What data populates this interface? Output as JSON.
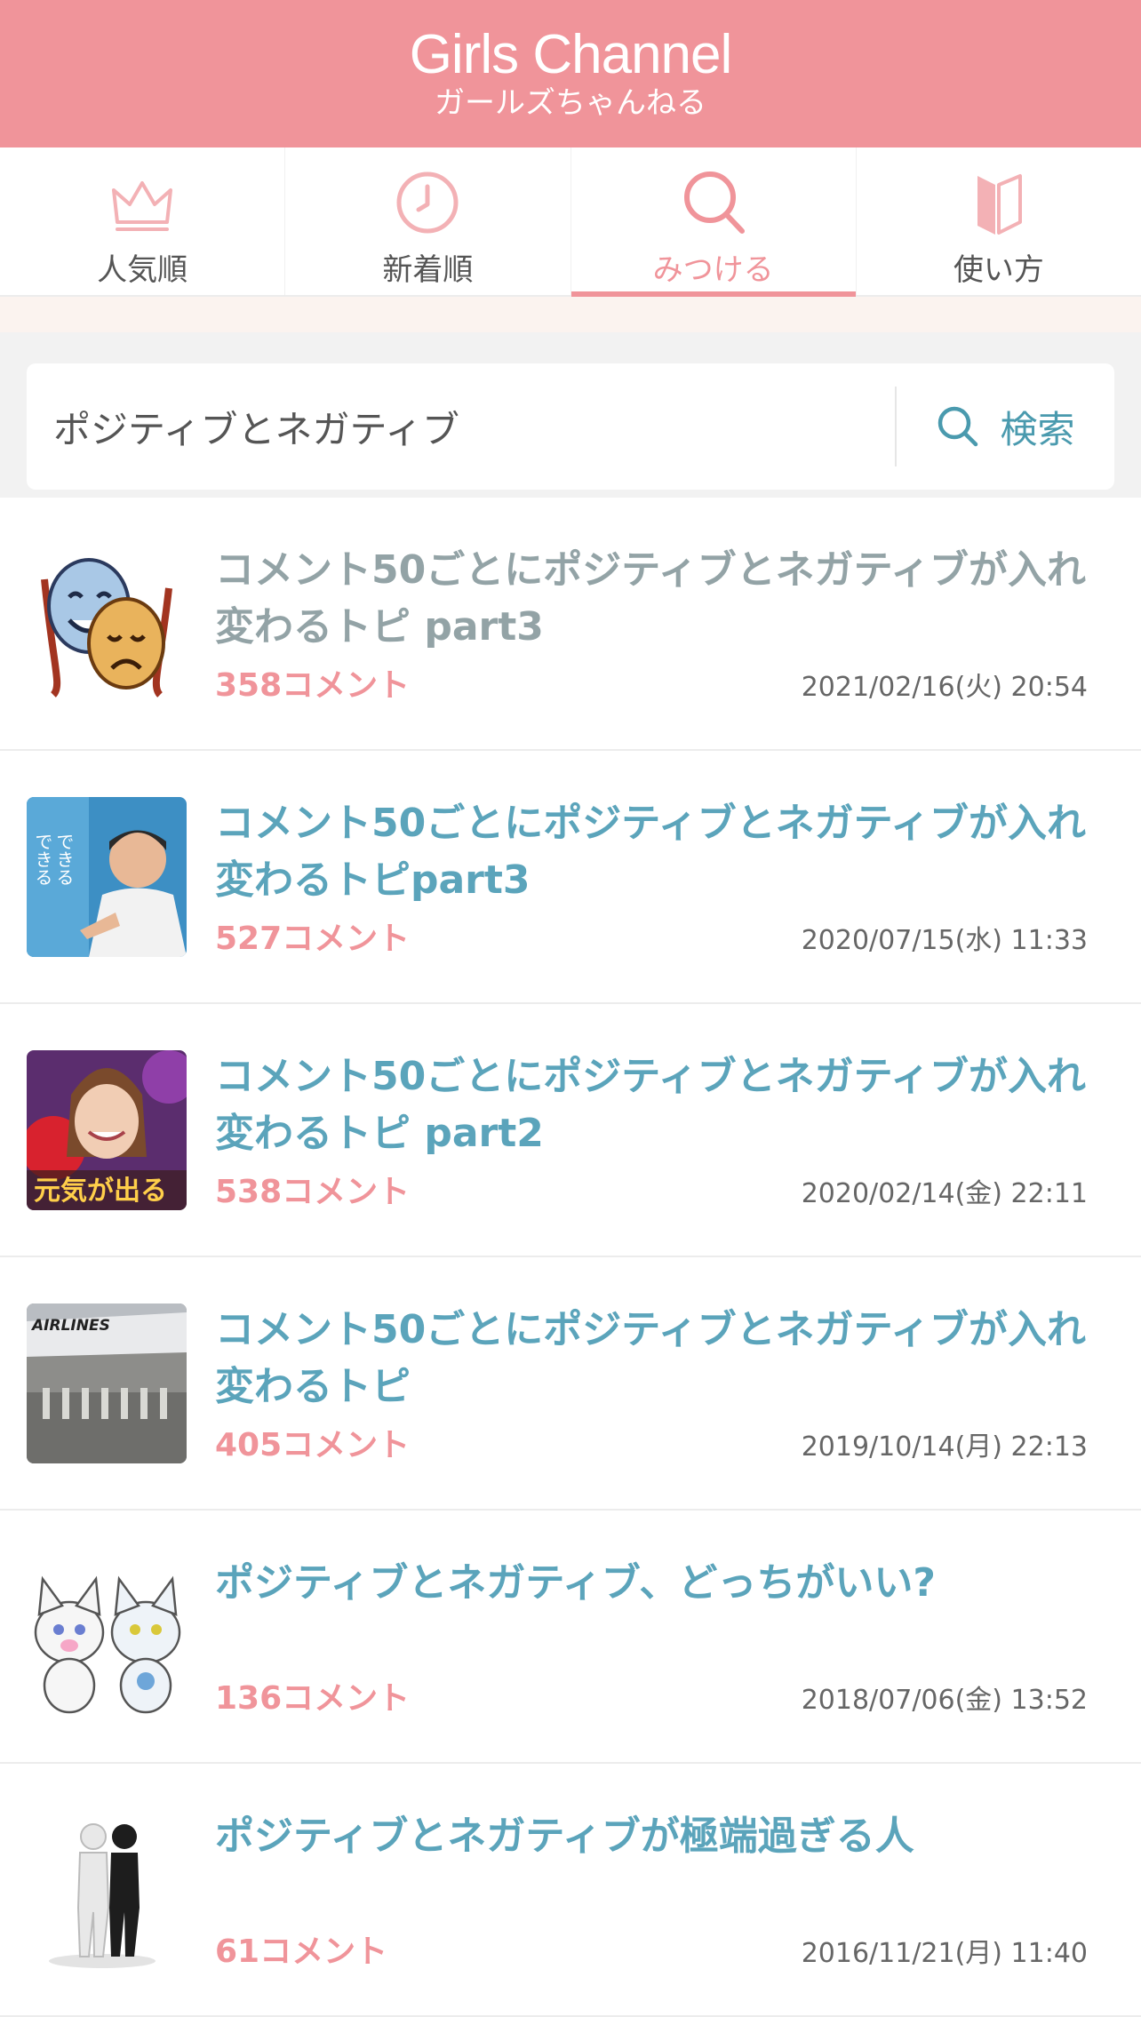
{
  "header": {
    "title": "Girls Channel",
    "subtitle": "ガールズちゃんねる",
    "color": "#f0949a"
  },
  "tabs": [
    {
      "label": "人気順",
      "icon": "crown-icon",
      "active": false
    },
    {
      "label": "新着順",
      "icon": "clock-icon",
      "active": false
    },
    {
      "label": "みつける",
      "icon": "search-icon",
      "active": true
    },
    {
      "label": "使い方",
      "icon": "book-icon",
      "active": false
    }
  ],
  "search": {
    "value": "ポジティブとネガティブ",
    "button_label": "検索"
  },
  "results": [
    {
      "title": "コメント50ごとにポジティブとネガティブが入れ変わるトピ part3",
      "comments": "358コメント",
      "date": "2021/02/16(火) 20:54",
      "thumb": "drama-masks",
      "visited": true
    },
    {
      "title": "コメント50ごとにポジティブとネガティブが入れ変わるトピpart3",
      "comments": "527コメント",
      "date": "2020/07/15(水) 11:33",
      "thumb": "man-pointing",
      "visited": false
    },
    {
      "title": "コメント50ごとにポジティブとネガティブが入れ変わるトピ part2",
      "comments": "538コメント",
      "date": "2020/02/14(金) 22:11",
      "thumb": "woman-tv",
      "visited": false
    },
    {
      "title": "コメント50ごとにポジティブとネガティブが入れ変わるトピ",
      "comments": "405コメント",
      "date": "2019/10/14(月) 22:13",
      "thumb": "airplane",
      "visited": false
    },
    {
      "title": "ポジティブとネガティブ、どっちがいい?",
      "comments": "136コメント",
      "date": "2018/07/06(金) 13:52",
      "thumb": "cats",
      "visited": false
    },
    {
      "title": "ポジティブとネガティブが極端過ぎる人",
      "comments": "61コメント",
      "date": "2016/11/21(月) 11:40",
      "thumb": "figures",
      "visited": false
    }
  ]
}
